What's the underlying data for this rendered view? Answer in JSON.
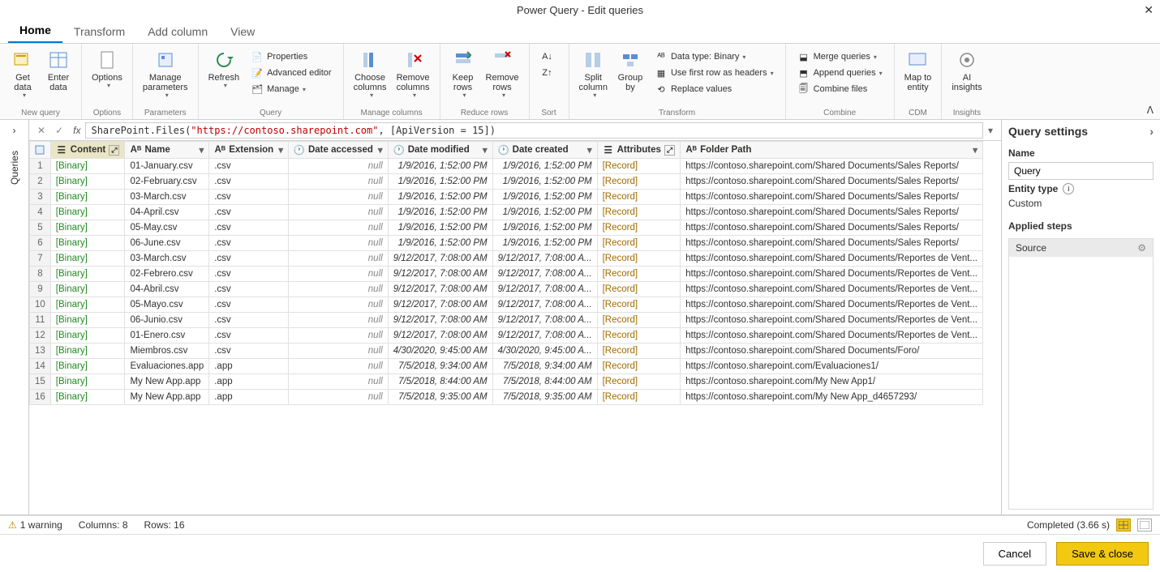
{
  "window_title": "Power Query - Edit queries",
  "tabs": {
    "home": "Home",
    "transform": "Transform",
    "addcolumn": "Add column",
    "view": "View"
  },
  "ribbon": {
    "newquery": {
      "label": "New query",
      "getdata": "Get\ndata",
      "enterdata": "Enter\ndata"
    },
    "options_grp": {
      "label": "Options",
      "options": "Options"
    },
    "parameters": {
      "label": "Parameters",
      "manage": "Manage\nparameters"
    },
    "query": {
      "label": "Query",
      "refresh": "Refresh",
      "properties": "Properties",
      "adv": "Advanced editor",
      "manage": "Manage"
    },
    "managecols": {
      "label": "Manage columns",
      "choose": "Choose\ncolumns",
      "remove": "Remove\ncolumns"
    },
    "reducerows": {
      "label": "Reduce rows",
      "keep": "Keep\nrows",
      "remove": "Remove\nrows"
    },
    "sort": {
      "label": "Sort"
    },
    "transform": {
      "label": "Transform",
      "split": "Split\ncolumn",
      "groupby": "Group\nby",
      "datatype": "Data type: Binary",
      "firstrow": "Use first row as headers",
      "replace": "Replace values"
    },
    "combine": {
      "label": "Combine",
      "merge": "Merge queries",
      "append": "Append queries",
      "files": "Combine files"
    },
    "cdm": {
      "label": "CDM",
      "mapentity": "Map to\nentity"
    },
    "insights": {
      "label": "Insights",
      "ai": "AI\ninsights"
    }
  },
  "queries_panel": "Queries",
  "formula": {
    "prefix": "SharePoint.Files(",
    "url": "\"https://contoso.sharepoint.com\"",
    "suffix": ", [ApiVersion = 15])"
  },
  "columns": {
    "content": "Content",
    "name": "Name",
    "extension": "Extension",
    "dateaccessed": "Date accessed",
    "datemodified": "Date modified",
    "datecreated": "Date created",
    "attributes": "Attributes",
    "folder": "Folder Path"
  },
  "cell_binary": "[Binary]",
  "cell_record": "[Record]",
  "cell_null": "null",
  "rows": [
    {
      "name": "01-January.csv",
      "ext": ".csv",
      "mod": "1/9/2016, 1:52:00 PM",
      "cre": "1/9/2016, 1:52:00 PM",
      "path": "https://contoso.sharepoint.com/Shared Documents/Sales Reports/"
    },
    {
      "name": "02-February.csv",
      "ext": ".csv",
      "mod": "1/9/2016, 1:52:00 PM",
      "cre": "1/9/2016, 1:52:00 PM",
      "path": "https://contoso.sharepoint.com/Shared Documents/Sales Reports/"
    },
    {
      "name": "03-March.csv",
      "ext": ".csv",
      "mod": "1/9/2016, 1:52:00 PM",
      "cre": "1/9/2016, 1:52:00 PM",
      "path": "https://contoso.sharepoint.com/Shared Documents/Sales Reports/"
    },
    {
      "name": "04-April.csv",
      "ext": ".csv",
      "mod": "1/9/2016, 1:52:00 PM",
      "cre": "1/9/2016, 1:52:00 PM",
      "path": "https://contoso.sharepoint.com/Shared Documents/Sales Reports/"
    },
    {
      "name": "05-May.csv",
      "ext": ".csv",
      "mod": "1/9/2016, 1:52:00 PM",
      "cre": "1/9/2016, 1:52:00 PM",
      "path": "https://contoso.sharepoint.com/Shared Documents/Sales Reports/"
    },
    {
      "name": "06-June.csv",
      "ext": ".csv",
      "mod": "1/9/2016, 1:52:00 PM",
      "cre": "1/9/2016, 1:52:00 PM",
      "path": "https://contoso.sharepoint.com/Shared Documents/Sales Reports/"
    },
    {
      "name": "03-March.csv",
      "ext": ".csv",
      "mod": "9/12/2017, 7:08:00 AM",
      "cre": "9/12/2017, 7:08:00 A...",
      "path": "https://contoso.sharepoint.com/Shared Documents/Reportes de Vent..."
    },
    {
      "name": "02-Febrero.csv",
      "ext": ".csv",
      "mod": "9/12/2017, 7:08:00 AM",
      "cre": "9/12/2017, 7:08:00 A...",
      "path": "https://contoso.sharepoint.com/Shared Documents/Reportes de Vent..."
    },
    {
      "name": "04-Abril.csv",
      "ext": ".csv",
      "mod": "9/12/2017, 7:08:00 AM",
      "cre": "9/12/2017, 7:08:00 A...",
      "path": "https://contoso.sharepoint.com/Shared Documents/Reportes de Vent..."
    },
    {
      "name": "05-Mayo.csv",
      "ext": ".csv",
      "mod": "9/12/2017, 7:08:00 AM",
      "cre": "9/12/2017, 7:08:00 A...",
      "path": "https://contoso.sharepoint.com/Shared Documents/Reportes de Vent..."
    },
    {
      "name": "06-Junio.csv",
      "ext": ".csv",
      "mod": "9/12/2017, 7:08:00 AM",
      "cre": "9/12/2017, 7:08:00 A...",
      "path": "https://contoso.sharepoint.com/Shared Documents/Reportes de Vent..."
    },
    {
      "name": "01-Enero.csv",
      "ext": ".csv",
      "mod": "9/12/2017, 7:08:00 AM",
      "cre": "9/12/2017, 7:08:00 A...",
      "path": "https://contoso.sharepoint.com/Shared Documents/Reportes de Vent..."
    },
    {
      "name": "Miembros.csv",
      "ext": ".csv",
      "mod": "4/30/2020, 9:45:00 AM",
      "cre": "4/30/2020, 9:45:00 A...",
      "path": "https://contoso.sharepoint.com/Shared Documents/Foro/"
    },
    {
      "name": "Evaluaciones.app",
      "ext": ".app",
      "mod": "7/5/2018, 9:34:00 AM",
      "cre": "7/5/2018, 9:34:00 AM",
      "path": "https://contoso.sharepoint.com/Evaluaciones1/"
    },
    {
      "name": "My New App.app",
      "ext": ".app",
      "mod": "7/5/2018, 8:44:00 AM",
      "cre": "7/5/2018, 8:44:00 AM",
      "path": "https://contoso.sharepoint.com/My New App1/"
    },
    {
      "name": "My New App.app",
      "ext": ".app",
      "mod": "7/5/2018, 9:35:00 AM",
      "cre": "7/5/2018, 9:35:00 AM",
      "path": "https://contoso.sharepoint.com/My New App_d4657293/"
    }
  ],
  "settings": {
    "title": "Query settings",
    "name_label": "Name",
    "name_value": "Query",
    "entity_label": "Entity type",
    "entity_value": "Custom",
    "steps_label": "Applied steps",
    "step1": "Source"
  },
  "status": {
    "warning": "1 warning",
    "columns": "Columns: 8",
    "rows": "Rows: 16",
    "completed": "Completed (3.66 s)"
  },
  "footer": {
    "cancel": "Cancel",
    "save": "Save & close"
  }
}
